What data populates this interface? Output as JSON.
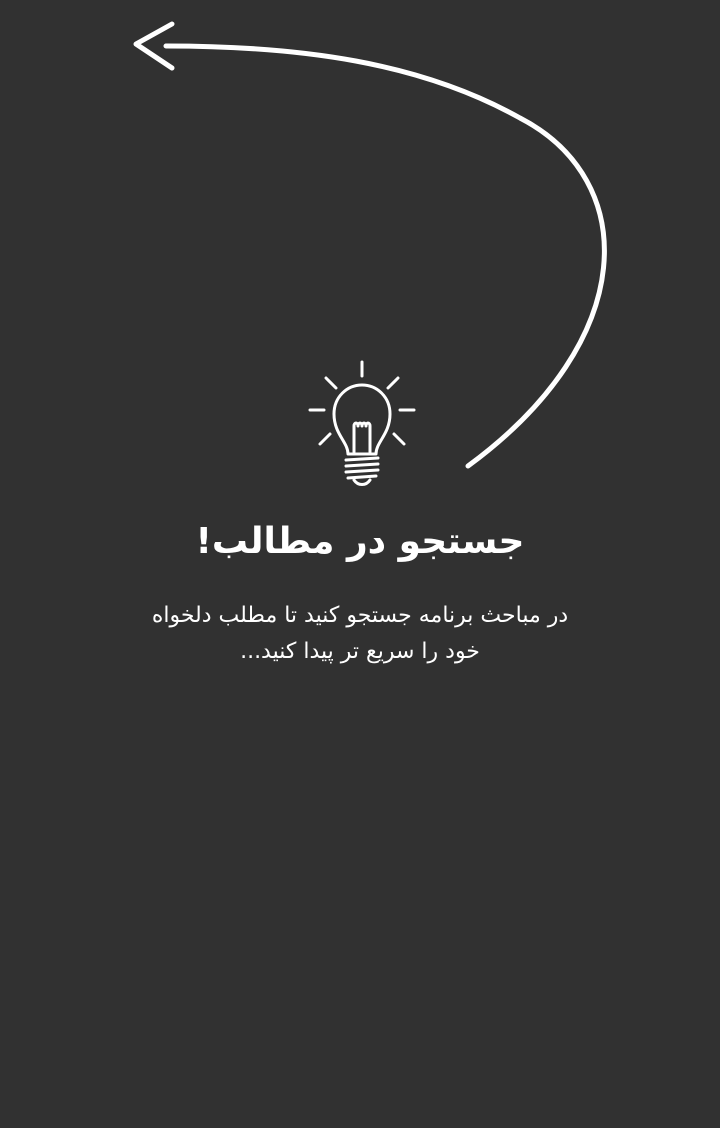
{
  "theme": {
    "background": "#313131",
    "foreground": "#ffffff"
  },
  "hint": {
    "icon": "lightbulb-icon",
    "pointer": "curved-arrow-icon",
    "title": "جستجو در مطالب!",
    "description_line1": "در مباحث برنامه جستجو کنید تا مطلب دلخواه",
    "description_line2": "خود را سریع تر پیدا کنید..."
  }
}
